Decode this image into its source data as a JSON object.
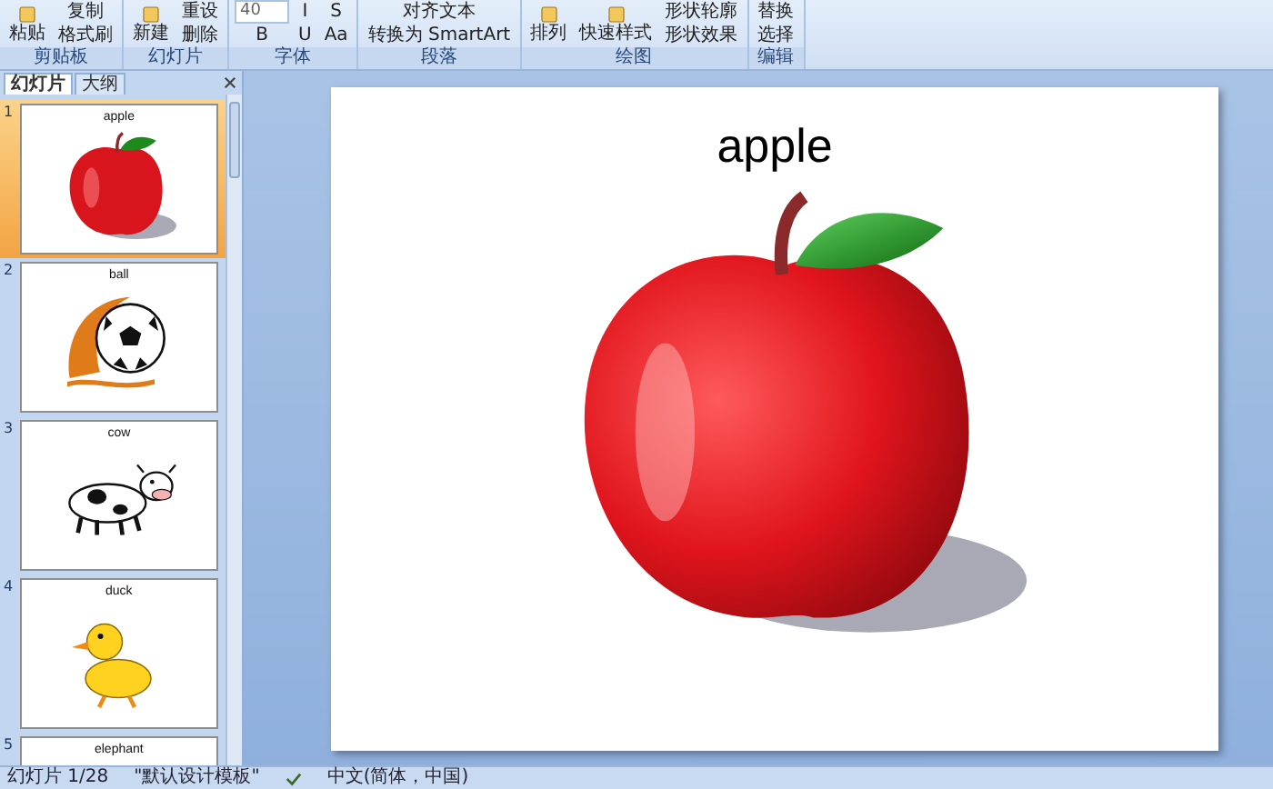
{
  "ribbon": {
    "groups": [
      {
        "label": "剪贴板",
        "items": [
          {
            "kind": "large",
            "label": "粘贴"
          },
          {
            "kind": "small",
            "label": "复制"
          },
          {
            "kind": "small",
            "label": "格式刷"
          }
        ]
      },
      {
        "label": "幻灯片",
        "items": [
          {
            "kind": "large",
            "label": "新建"
          },
          {
            "kind": "small",
            "label": "重设"
          },
          {
            "kind": "small",
            "label": "删除"
          }
        ]
      },
      {
        "label": "字体",
        "items": [
          {
            "kind": "field",
            "label": "40"
          },
          {
            "kind": "small",
            "label": "B"
          },
          {
            "kind": "small",
            "label": "I"
          },
          {
            "kind": "small",
            "label": "U"
          },
          {
            "kind": "small",
            "label": "S"
          },
          {
            "kind": "small",
            "label": "Aa"
          }
        ]
      },
      {
        "label": "段落",
        "items": [
          {
            "kind": "small",
            "label": "对齐文本"
          },
          {
            "kind": "small",
            "label": "转换为 SmartArt"
          }
        ]
      },
      {
        "label": "绘图",
        "items": [
          {
            "kind": "large",
            "label": "排列"
          },
          {
            "kind": "large",
            "label": "快速样式"
          },
          {
            "kind": "small",
            "label": "形状轮廓"
          },
          {
            "kind": "small",
            "label": "形状效果"
          }
        ]
      },
      {
        "label": "编辑",
        "items": [
          {
            "kind": "small",
            "label": "替换"
          },
          {
            "kind": "small",
            "label": "选择"
          }
        ]
      }
    ]
  },
  "pane_tabs": [
    {
      "label": "幻灯片",
      "selected": true
    },
    {
      "label": "大纲",
      "selected": false
    }
  ],
  "slides": [
    {
      "number": "1",
      "title": "apple",
      "kind": "apple",
      "selected": true
    },
    {
      "number": "2",
      "title": "ball",
      "kind": "ball",
      "selected": false
    },
    {
      "number": "3",
      "title": "cow",
      "kind": "cow",
      "selected": false
    },
    {
      "number": "4",
      "title": "duck",
      "kind": "duck",
      "selected": false
    },
    {
      "number": "5",
      "title": "elephant",
      "selected": false
    }
  ],
  "current_slide": {
    "title": "apple",
    "kind": "apple"
  },
  "status_bar": {
    "position": "幻灯片 1/28",
    "theme": "\"默认设计模板\"",
    "language": "中文(简体，中国)"
  }
}
